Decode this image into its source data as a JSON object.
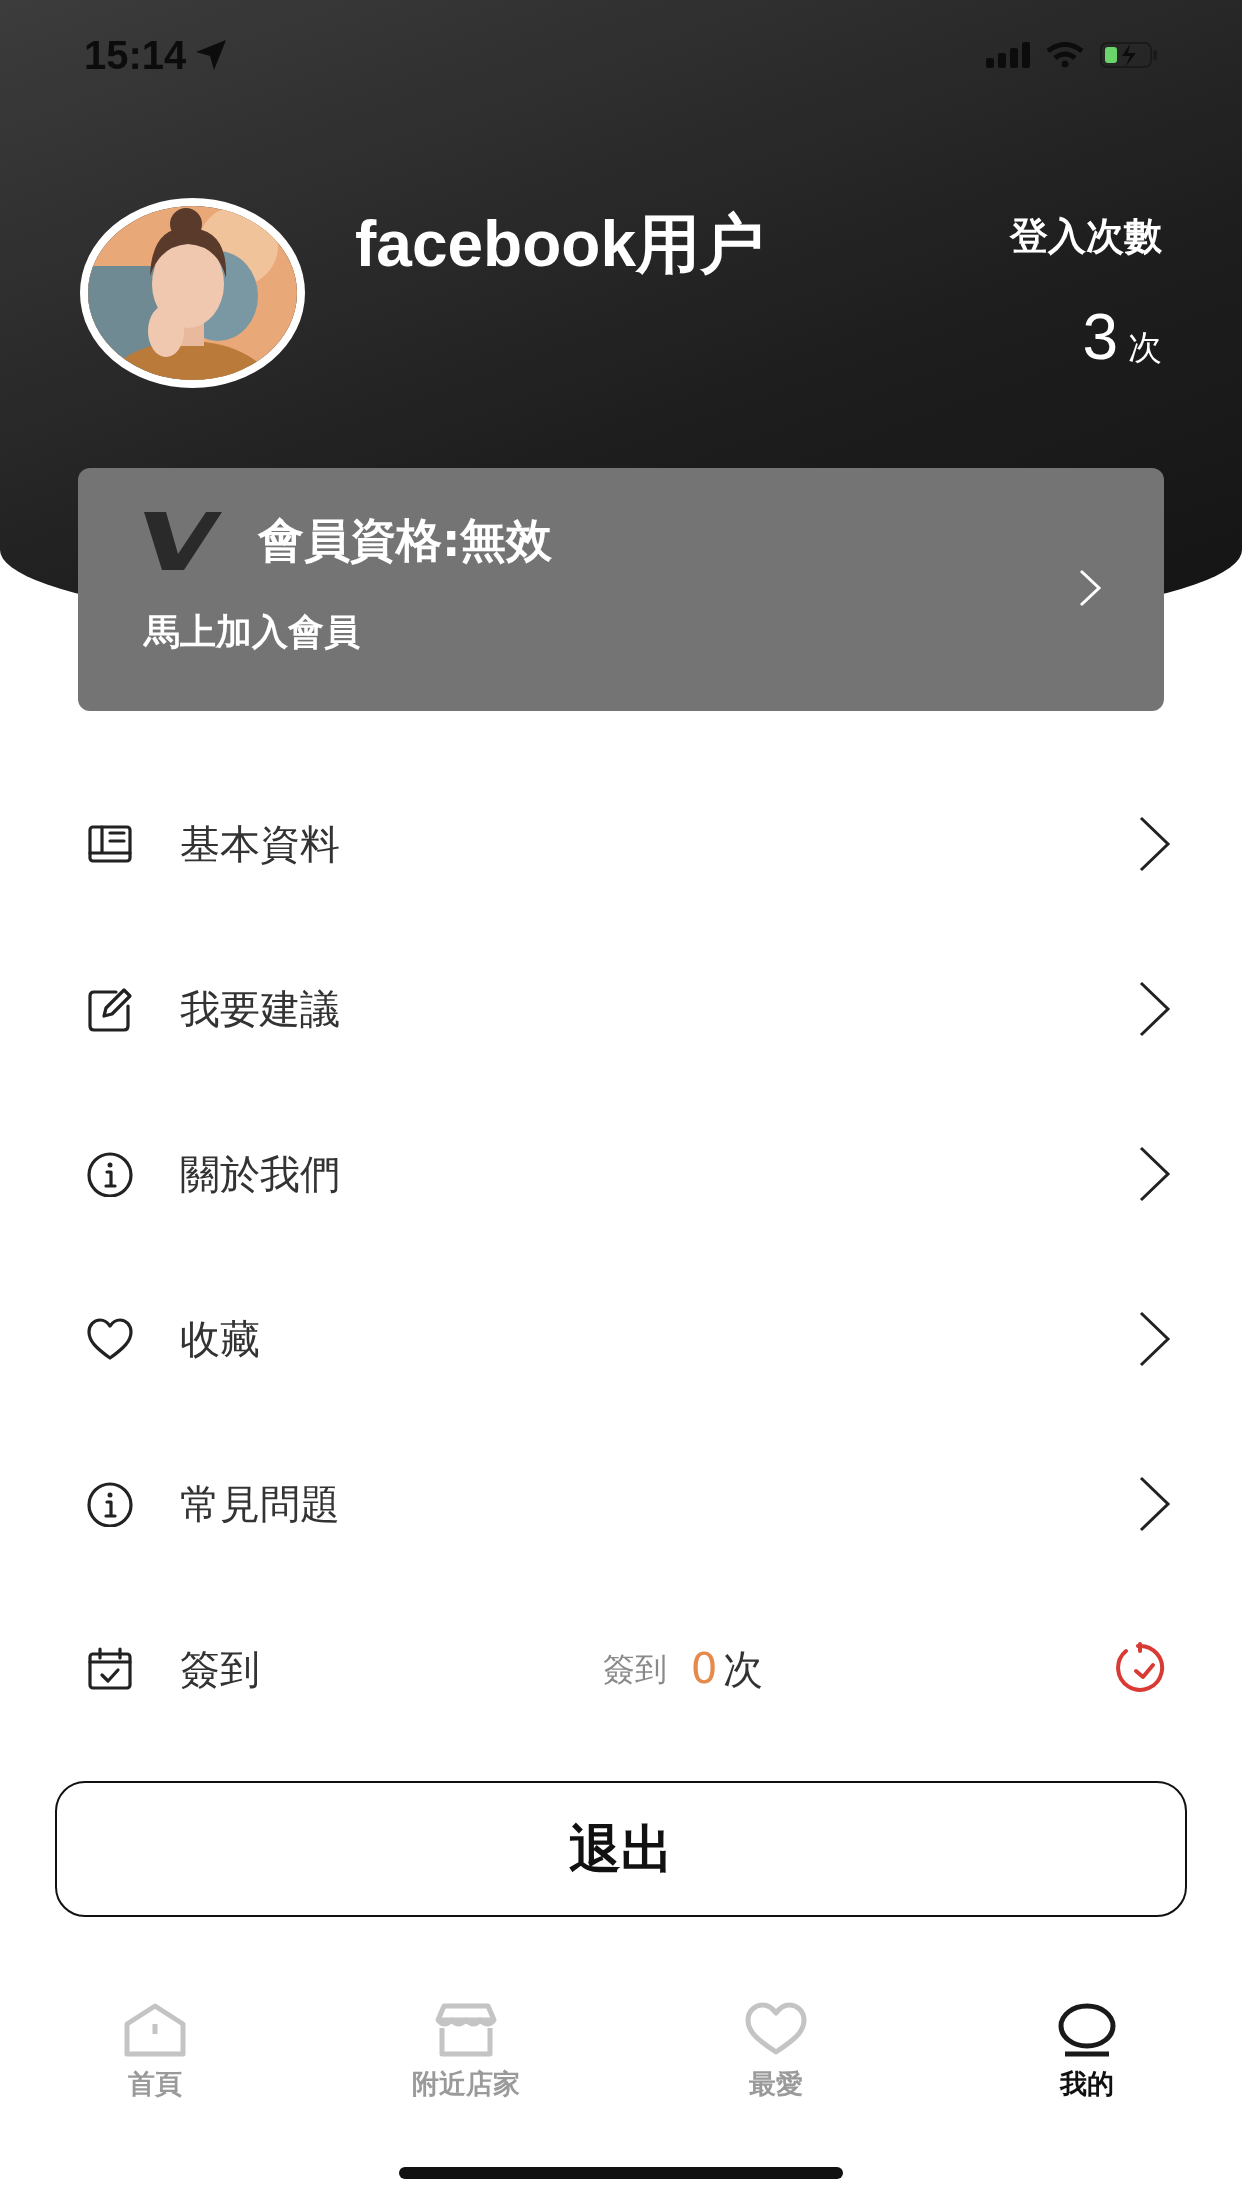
{
  "status_bar": {
    "time": "15:14"
  },
  "profile": {
    "name": "facebook用户",
    "login_label": "登入次數",
    "login_count": "3",
    "login_unit": "次"
  },
  "membership": {
    "title": "會員資格:無效",
    "subtitle": "馬上加入會員"
  },
  "menu": [
    {
      "kind": "link",
      "label": "基本資料"
    },
    {
      "kind": "link",
      "label": "我要建議"
    },
    {
      "kind": "link",
      "label": "關於我們"
    },
    {
      "kind": "link",
      "label": "收藏"
    },
    {
      "kind": "link",
      "label": "常見問題"
    },
    {
      "kind": "checkin",
      "label": "簽到",
      "checkin_label": "簽到",
      "checkin_count": "0",
      "checkin_unit": "次"
    }
  ],
  "logout_button": "退出",
  "tabs": [
    {
      "label": "首頁",
      "selected": false
    },
    {
      "label": "附近店家",
      "selected": false
    },
    {
      "label": "最愛",
      "selected": false
    },
    {
      "label": "我的",
      "selected": true
    }
  ]
}
